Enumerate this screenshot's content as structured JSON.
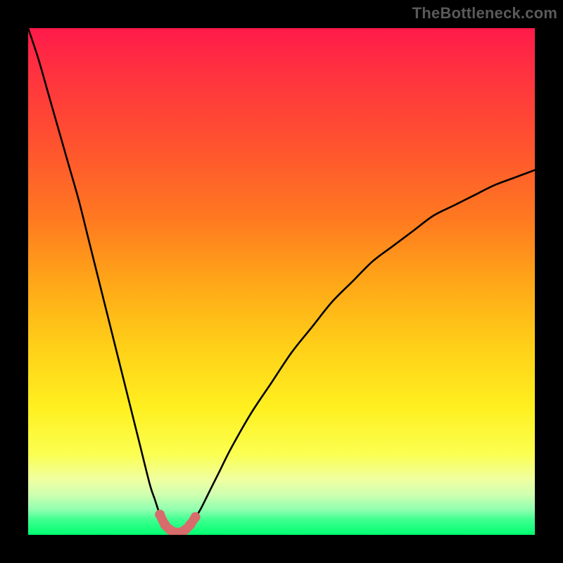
{
  "watermark": "TheBottleneck.com",
  "chart_data": {
    "type": "line",
    "title": "",
    "xlabel": "",
    "ylabel": "",
    "xlim": [
      0,
      100
    ],
    "ylim": [
      0,
      100
    ],
    "grid": false,
    "series": [
      {
        "name": "bottleneck-curve",
        "x": [
          0,
          2,
          4,
          6,
          8,
          10,
          12,
          14,
          16,
          18,
          20,
          22,
          24,
          25,
          26,
          27,
          28,
          29,
          30,
          31,
          32,
          33,
          34,
          36,
          38,
          40,
          44,
          48,
          52,
          56,
          60,
          64,
          68,
          72,
          76,
          80,
          84,
          88,
          92,
          96,
          100
        ],
        "y": [
          100,
          94,
          87,
          80,
          73,
          66,
          58,
          50,
          42,
          34,
          26,
          18,
          10,
          7,
          4,
          2,
          1,
          0.5,
          0.5,
          1,
          2,
          3.5,
          5,
          9,
          13,
          17,
          24,
          30,
          36,
          41,
          46,
          50,
          54,
          57,
          60,
          63,
          65,
          67,
          69,
          70.5,
          72
        ]
      }
    ],
    "markers": {
      "name": "highlight-dots",
      "color": "#d86b6b",
      "points": [
        {
          "x": 26,
          "y": 4
        },
        {
          "x": 27,
          "y": 2
        },
        {
          "x": 28,
          "y": 1
        },
        {
          "x": 29,
          "y": 0.5
        },
        {
          "x": 30,
          "y": 0.5
        },
        {
          "x": 31,
          "y": 1
        },
        {
          "x": 32,
          "y": 2
        },
        {
          "x": 33,
          "y": 3.5
        }
      ]
    },
    "gradient_stops": [
      {
        "pos": 0,
        "color": "#ff1a4a"
      },
      {
        "pos": 8,
        "color": "#ff3040"
      },
      {
        "pos": 22,
        "color": "#ff5030"
      },
      {
        "pos": 38,
        "color": "#ff7a20"
      },
      {
        "pos": 50,
        "color": "#ffa618"
      },
      {
        "pos": 63,
        "color": "#ffd018"
      },
      {
        "pos": 75,
        "color": "#fff020"
      },
      {
        "pos": 84,
        "color": "#fbff50"
      },
      {
        "pos": 89,
        "color": "#f0ffa0"
      },
      {
        "pos": 92,
        "color": "#d0ffb0"
      },
      {
        "pos": 95,
        "color": "#90ffb0"
      },
      {
        "pos": 97,
        "color": "#40ff90"
      },
      {
        "pos": 100,
        "color": "#00ff70"
      }
    ]
  }
}
